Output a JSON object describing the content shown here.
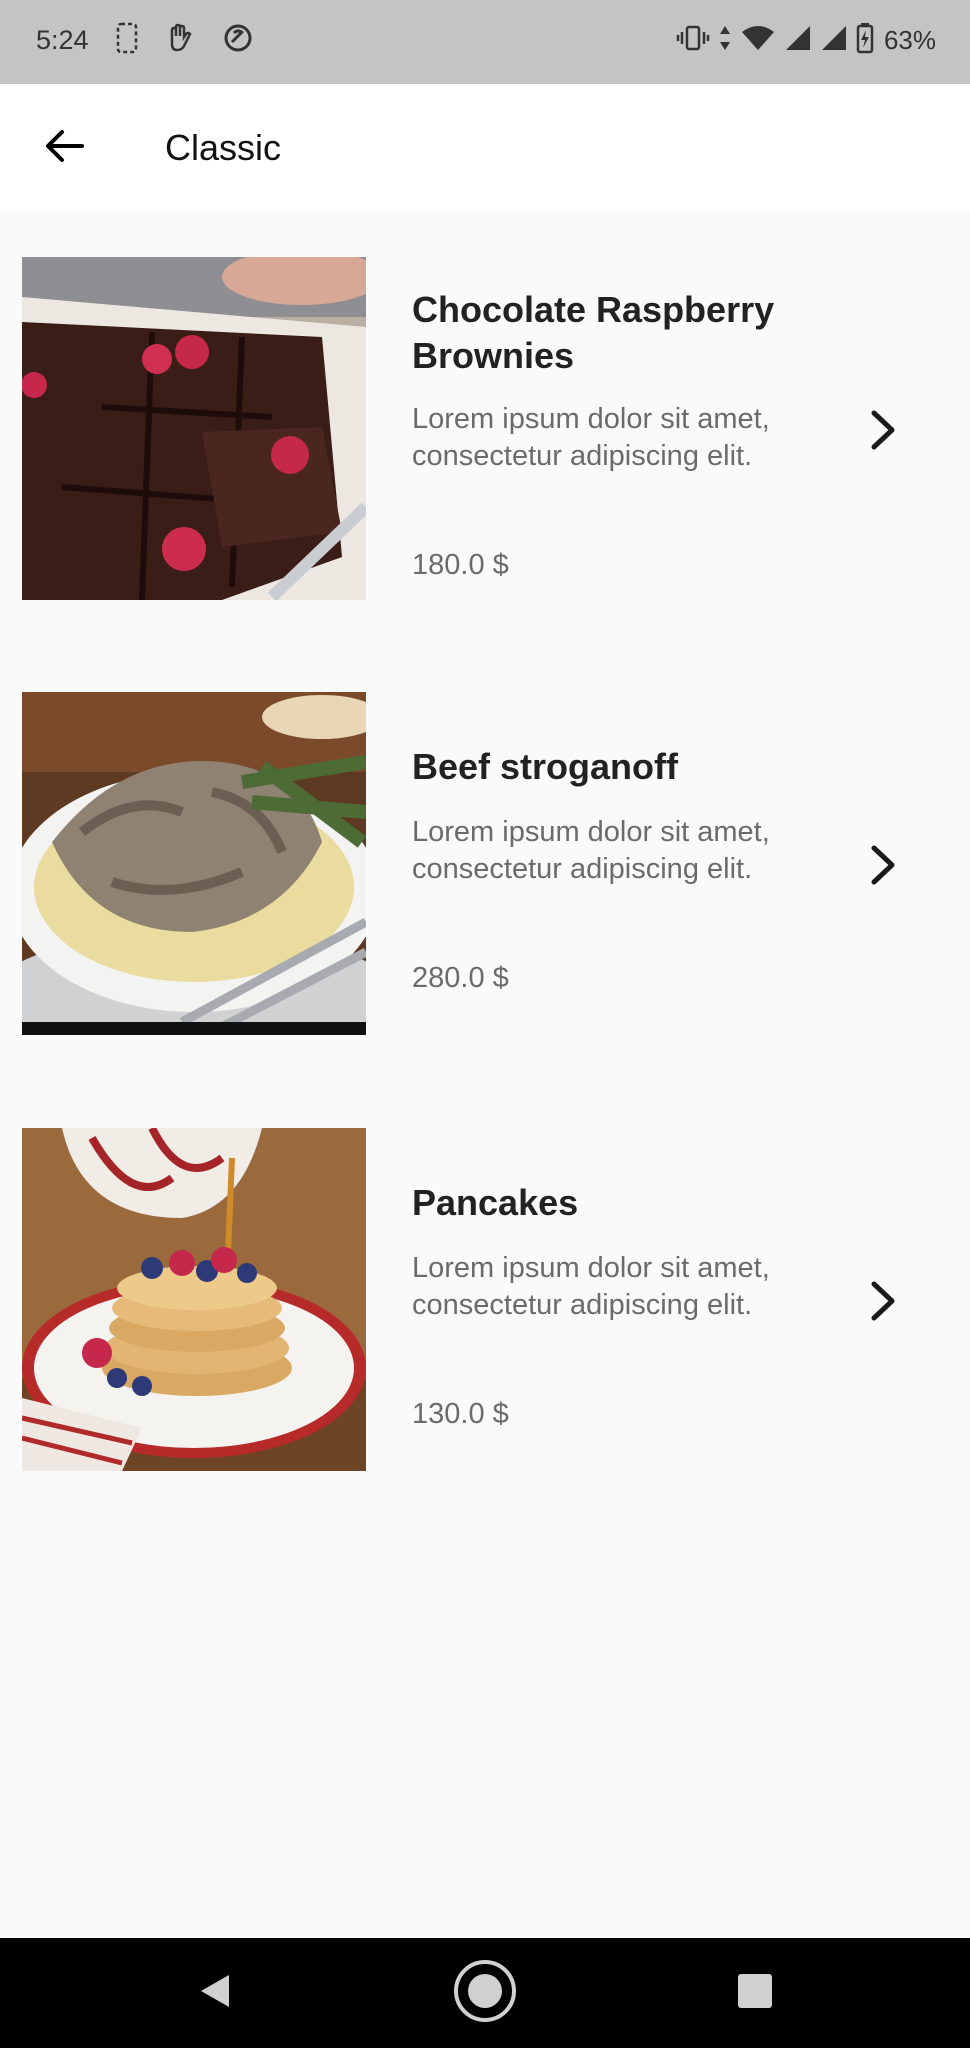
{
  "status_bar": {
    "time": "5:24",
    "battery_percent": "63%",
    "icons": [
      "vibrate-icon",
      "data-arrows-icon",
      "wifi-icon",
      "signal-icon",
      "signal-icon",
      "battery-charging-icon"
    ]
  },
  "app_bar": {
    "title": "Classic",
    "back_icon": "arrow-left-icon"
  },
  "items": [
    {
      "title": "Chocolate Raspberry Brownies",
      "description": "Lorem ipsum dolor sit amet, consectetur adipiscing elit.",
      "price": "180.0 $",
      "image": "brownies-photo"
    },
    {
      "title": "Beef stroganoff",
      "description": "Lorem ipsum dolor sit amet, consectetur adipiscing elit.",
      "price": "280.0 $",
      "image": "stroganoff-photo"
    },
    {
      "title": "Pancakes",
      "description": "Lorem ipsum dolor sit amet, consectetur adipiscing elit.",
      "price": "130.0 $",
      "image": "pancakes-photo"
    }
  ],
  "nav_bar": {
    "buttons": [
      "back-triangle-icon",
      "home-circle-icon",
      "recents-square-icon"
    ]
  },
  "colors": {
    "status_bar": "#c4c4c4",
    "app_bar": "#ffffff",
    "background": "#fafafa",
    "title_text": "#222222",
    "secondary_text": "#6b6b6b",
    "nav_bar": "#000000"
  }
}
